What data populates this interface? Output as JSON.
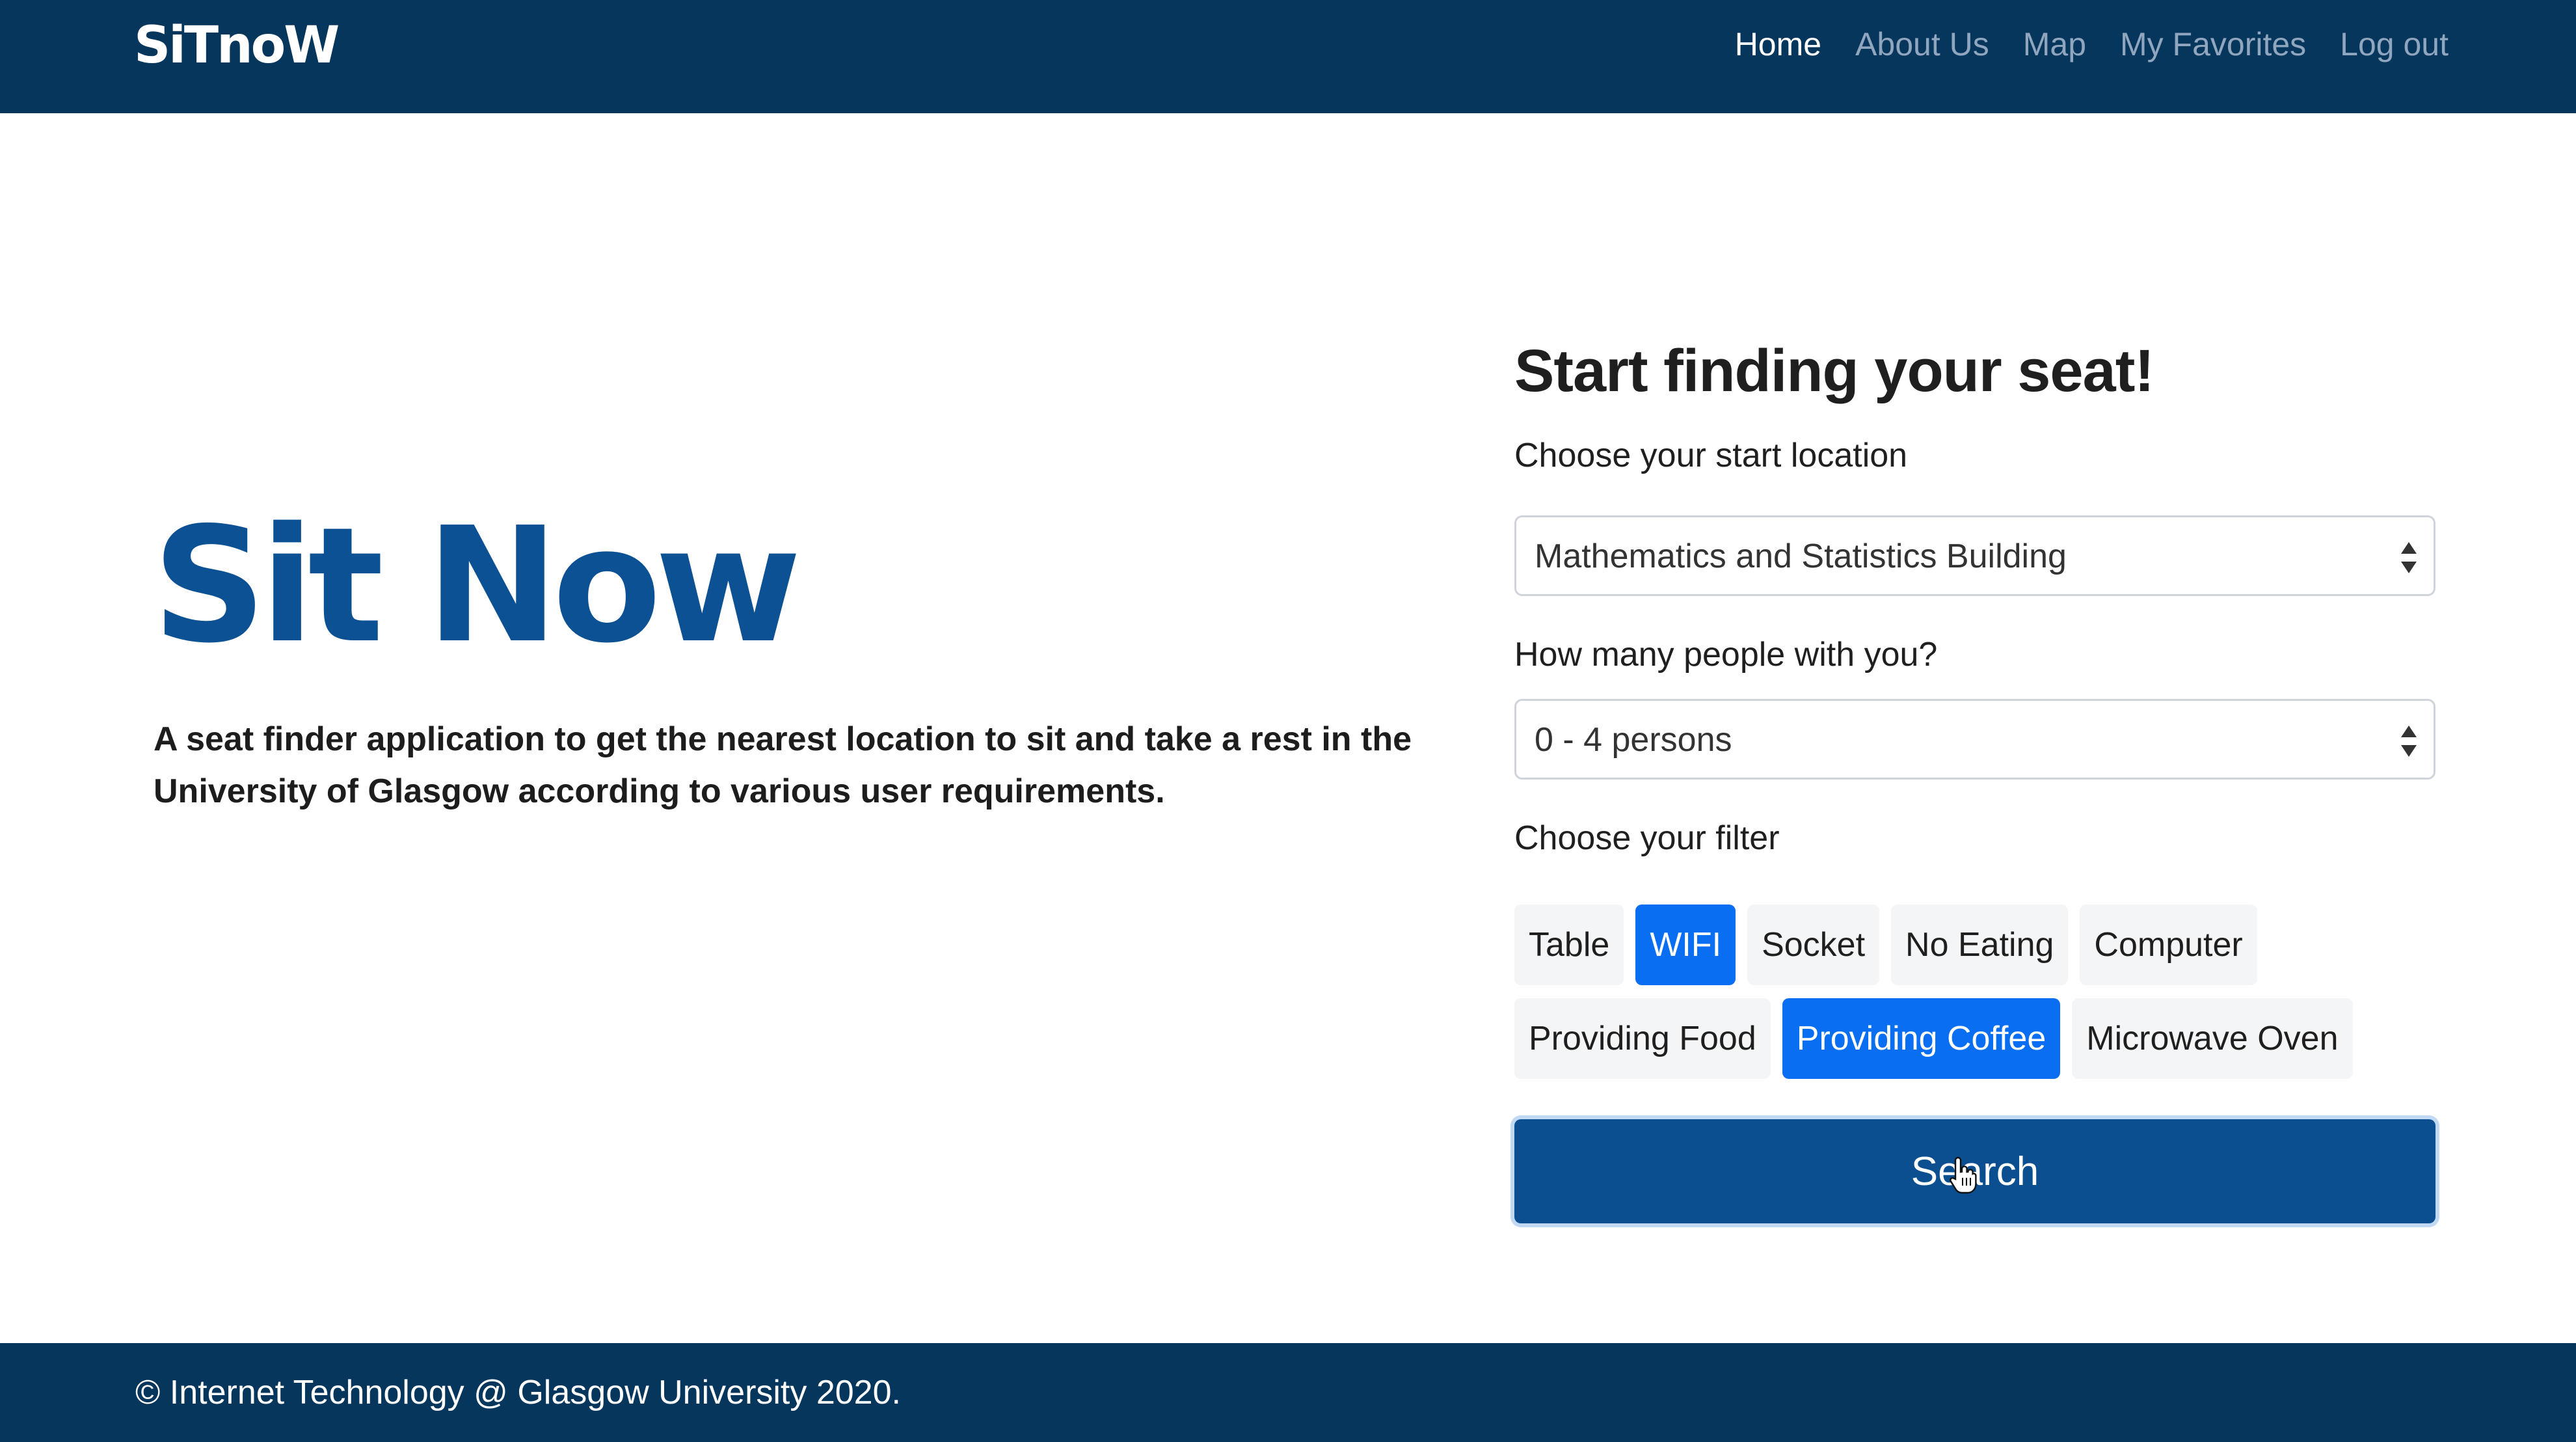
{
  "navbar": {
    "brand": "SiTnoW",
    "links": [
      {
        "label": "Home",
        "active": true
      },
      {
        "label": "About Us",
        "active": false
      },
      {
        "label": "Map",
        "active": false
      },
      {
        "label": "My Favorites",
        "active": false
      },
      {
        "label": "Log out",
        "active": false
      }
    ]
  },
  "hero": {
    "title": "Sit Now",
    "description": "A seat finder application to get the nearest location to sit and take a rest in the University of Glasgow according to various user requirements."
  },
  "form": {
    "title": "Start finding your seat!",
    "location_label": "Choose your start location",
    "location_value": "Mathematics and Statistics Building",
    "people_label": "How many people with you?",
    "people_value": "0 - 4 persons",
    "filter_label": "Choose your filter",
    "filters": [
      {
        "label": "Table",
        "selected": false
      },
      {
        "label": "WIFI",
        "selected": true
      },
      {
        "label": "Socket",
        "selected": false
      },
      {
        "label": "No Eating",
        "selected": false
      },
      {
        "label": "Computer",
        "selected": false
      },
      {
        "label": "Providing Food",
        "selected": false
      },
      {
        "label": "Providing Coffee",
        "selected": true
      },
      {
        "label": "Microwave Oven",
        "selected": false
      }
    ],
    "search_label": "Search"
  },
  "footer": {
    "text": "© Internet Technology @ Glasgow University 2020."
  },
  "colors": {
    "navbar_bg": "#07365d",
    "accent": "#0b4f90",
    "chip_selected": "#0a6ef2",
    "hero_title": "#0c5194"
  },
  "icons": {
    "cursor": "hand-pointer-icon",
    "select_arrows": "sort-arrows-icon"
  }
}
